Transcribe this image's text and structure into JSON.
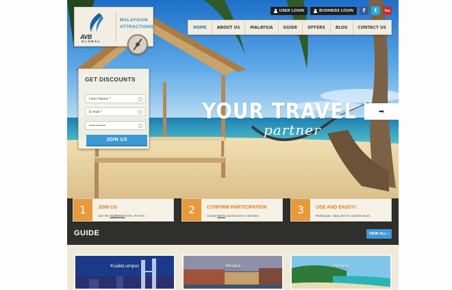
{
  "topbar": {
    "user_login": "USER LOGIN",
    "business_login": "BUSINESS LOGIN",
    "social": [
      {
        "name": "facebook-icon",
        "glyph": "f"
      },
      {
        "name": "twitter-icon",
        "glyph": "t"
      },
      {
        "name": "youtube-icon",
        "glyph": "You"
      }
    ]
  },
  "nav": {
    "items": [
      "HOME",
      "ABOUT US",
      "MALAYSIA",
      "GUIDE",
      "OFFERS",
      "BLOG",
      "CONTACT US"
    ],
    "active": "HOME"
  },
  "logo": {
    "brand": "AVB",
    "brand_sub": "GLOBAL",
    "tagline_line1": "MALAYSIAN",
    "tagline_line2": "ATTRACTIONS"
  },
  "discount": {
    "title": "GET DISCOUNTS",
    "username_placeholder": "User Name *",
    "email_placeholder": "E-mail *",
    "password_value": "••••••••••",
    "join_label": "JOIN US"
  },
  "hero": {
    "slogan_line1": "YOUR TRAVEL",
    "slogan_line2": "partner",
    "next_arrow": "➡"
  },
  "steps": [
    {
      "number": "1",
      "title": "JOIN US",
      "desc_pre": "Use the ",
      "desc_link": "registration",
      "desc_post": " form. It's free."
    },
    {
      "number": "2",
      "title": "CONFIRM PARTICIPATION",
      "desc_pre": "Accept ",
      "desc_link": "terms",
      "desc_post": " and become a member."
    },
    {
      "number": "3",
      "title": "USE AND ENJOY!",
      "desc_pre": "Participate, enjoy the fun and the tours.",
      "desc_link": "",
      "desc_post": ""
    }
  ],
  "guide": {
    "title": "GUIDE",
    "view_all": "VIEW ALL",
    "cards": [
      "KualaLumpur",
      "Melaka",
      "Penang"
    ]
  },
  "colors": {
    "accent_blue": "#3b99d4",
    "accent_orange": "#e79a3a",
    "dark_bg": "#2f2f2d"
  }
}
